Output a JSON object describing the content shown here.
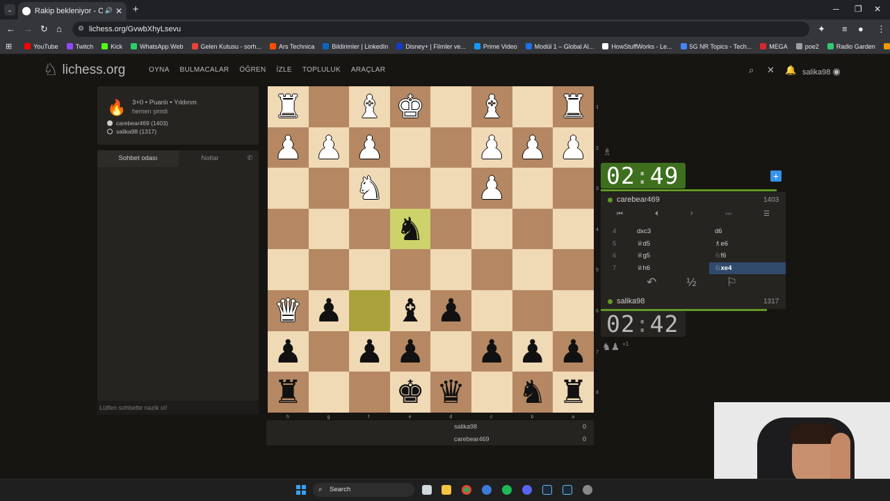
{
  "browser": {
    "tab_title": "Rakip bekleniyor - Oyna ca",
    "url": "lichess.org/GvwbXhyLsevu",
    "bookmarks": [
      {
        "label": "YouTube",
        "color": "#ff0000"
      },
      {
        "label": "Twitch",
        "color": "#9146ff"
      },
      {
        "label": "Kick",
        "color": "#53fc18"
      },
      {
        "label": "WhatsApp Web",
        "color": "#25d366"
      },
      {
        "label": "Gelen Kutusu - sorh...",
        "color": "#ea4335"
      },
      {
        "label": "Ars Technica",
        "color": "#ff4e00"
      },
      {
        "label": "Bildirimler | LinkedIn",
        "color": "#0a66c2"
      },
      {
        "label": "Disney+ | Filmler ve...",
        "color": "#113ccf"
      },
      {
        "label": "Prime Video",
        "color": "#1399ff"
      },
      {
        "label": "Modül 1 – Global Al...",
        "color": "#1a73e8"
      },
      {
        "label": "HowStuffWorks - Le...",
        "color": "#ffffff"
      },
      {
        "label": "5G NR Topics - Tech...",
        "color": "#4285f4"
      },
      {
        "label": "MEGA",
        "color": "#d9272e"
      },
      {
        "label": "poe2",
        "color": "#9aa0a6"
      },
      {
        "label": "Radio Garden",
        "color": "#2ecc71"
      },
      {
        "label": "Takvim",
        "color": "#f29900"
      }
    ]
  },
  "site": {
    "logo": "lichess.org",
    "nav": [
      "OYNA",
      "BULMACALAR",
      "ÖĞREN",
      "İZLE",
      "TOPLULUK",
      "ARAÇLAR"
    ],
    "username": "salika98",
    "notif_count": "1"
  },
  "game": {
    "mode": "3+0 • Puanlı • Yıldırım",
    "when": "hemen şimdi",
    "player1": "carebear469 (1403)",
    "player2": "salika98 (1317)"
  },
  "chat": {
    "tab_chat": "Sohbet odası",
    "tab_notes": "Notlar",
    "placeholder": "Lütfen sohbette nazik ol!"
  },
  "board": {
    "ranks": [
      "1",
      "2",
      "3",
      "4",
      "5",
      "6",
      "7",
      "8"
    ],
    "files": [
      "h",
      "g",
      "f",
      "e",
      "d",
      "c",
      "b",
      "a"
    ],
    "rows": [
      [
        "wR",
        "",
        "wB",
        "wK",
        "",
        "wB",
        "",
        "wR"
      ],
      [
        "wP",
        "wP",
        "wP",
        "",
        "",
        "wP",
        "wP",
        "wP"
      ],
      [
        "",
        "",
        "wN",
        "",
        "",
        "wP",
        "",
        ""
      ],
      [
        "",
        "",
        "",
        "bN*",
        "",
        "",
        "",
        ""
      ],
      [
        "",
        "",
        "",
        "",
        "",
        "",
        "",
        ""
      ],
      [
        "wQ",
        "bP",
        "*",
        "bB",
        "bP",
        "",
        "",
        ""
      ],
      [
        "bP",
        "",
        "bP",
        "bP",
        "",
        "bP",
        "bP",
        "bP"
      ],
      [
        "bR",
        "",
        "",
        "bK",
        "bQ",
        "",
        "bN",
        "bR"
      ]
    ]
  },
  "score": {
    "p1": "salika98",
    "p1_score": "0",
    "p2": "carebear469",
    "p2_score": "0"
  },
  "clocks": {
    "top": {
      "min": "02",
      "sec": "49",
      "remaining_fraction": 0.95
    },
    "bottom": {
      "min": "02",
      "sec": "42",
      "remaining_fraction": 0.9
    }
  },
  "players": {
    "top": {
      "name": "carebear469",
      "rating": "1403"
    },
    "bottom": {
      "name": "salika98",
      "rating": "1317"
    }
  },
  "moves": [
    {
      "n": "4",
      "w": "dxc3",
      "b": "d6"
    },
    {
      "n": "5",
      "w": "♕d5",
      "b": "♗e6"
    },
    {
      "n": "6",
      "w": "♕g5",
      "b": "♘f6"
    },
    {
      "n": "7",
      "w": "♕h6",
      "b": "♘xe4"
    }
  ],
  "material": {
    "extra": "+1"
  }
}
